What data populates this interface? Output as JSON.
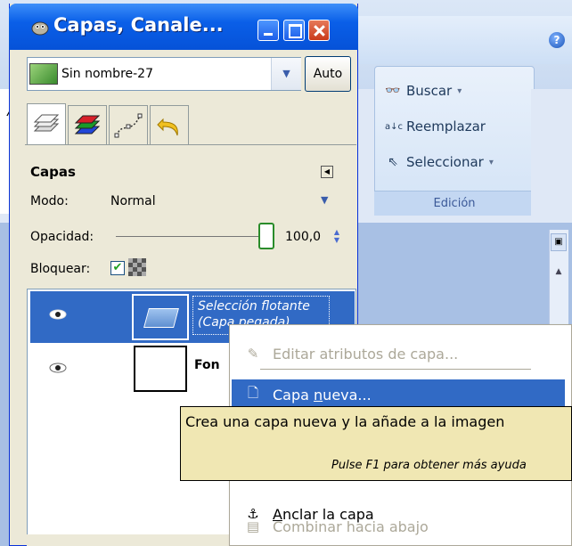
{
  "window": {
    "title": "Capas, Canale..."
  },
  "image_selector": {
    "value": "Sin nombre-27",
    "auto_label": "Auto"
  },
  "tabs": [
    {
      "name": "layers",
      "icon": "layers-icon"
    },
    {
      "name": "channels",
      "icon": "channels-icon"
    },
    {
      "name": "paths",
      "icon": "paths-icon"
    },
    {
      "name": "undo",
      "icon": "undo-icon"
    }
  ],
  "layers_panel": {
    "title": "Capas",
    "mode_label": "Modo:",
    "mode_value": "Normal",
    "opacity_label": "Opacidad:",
    "opacity_value": "100,0",
    "opacity_fraction": 1.0,
    "lock_label": "Bloquear:",
    "layers": [
      {
        "name": "Selección flotante",
        "subtitle": "(Capa pegada)",
        "selected": true
      },
      {
        "name": "Fon",
        "selected": false
      }
    ]
  },
  "ribbon": {
    "buscar": "Buscar",
    "reemplazar": "Reemplazar",
    "seleccionar": "Seleccionar",
    "group_label": "Edición",
    "left_letter": "A",
    "help_glyph": "?"
  },
  "context_menu": {
    "items": [
      {
        "label": "Editar atributos de capa...",
        "enabled": false
      },
      {
        "label": "Capa nueva...",
        "enabled": true,
        "highlighted": true
      },
      {
        "label": "Anclar la capa",
        "enabled": true
      },
      {
        "label": "Combinar hacia abajo",
        "enabled": false
      }
    ]
  },
  "tooltip": {
    "main": "Crea una capa nueva y la añade a la imagen",
    "help": "Pulse F1 para obtener más ayuda"
  },
  "colors": {
    "titlebar": "#0a5fe8",
    "selection": "#316ac5",
    "tooltip_bg": "#f0e7b3",
    "disabled_text": "#aca899"
  }
}
